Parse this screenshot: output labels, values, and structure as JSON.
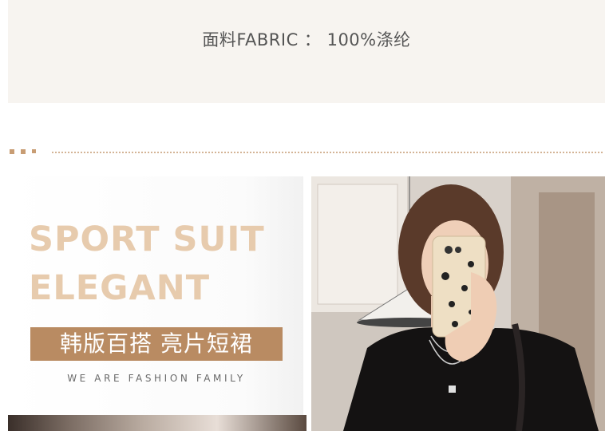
{
  "fabric": {
    "text": "面料FABRIC  ：  100%涤纶"
  },
  "headline": {
    "line1": "SPORT SUIT",
    "line2": "ELEGANT"
  },
  "banner": {
    "text": "韩版百搭 亮片短裙"
  },
  "tagline": {
    "text": "WE ARE FASHION FAMILY"
  },
  "colors": {
    "accent": "#b98b62",
    "headline": "#e7cbad",
    "panel": "#f7f4f0"
  }
}
